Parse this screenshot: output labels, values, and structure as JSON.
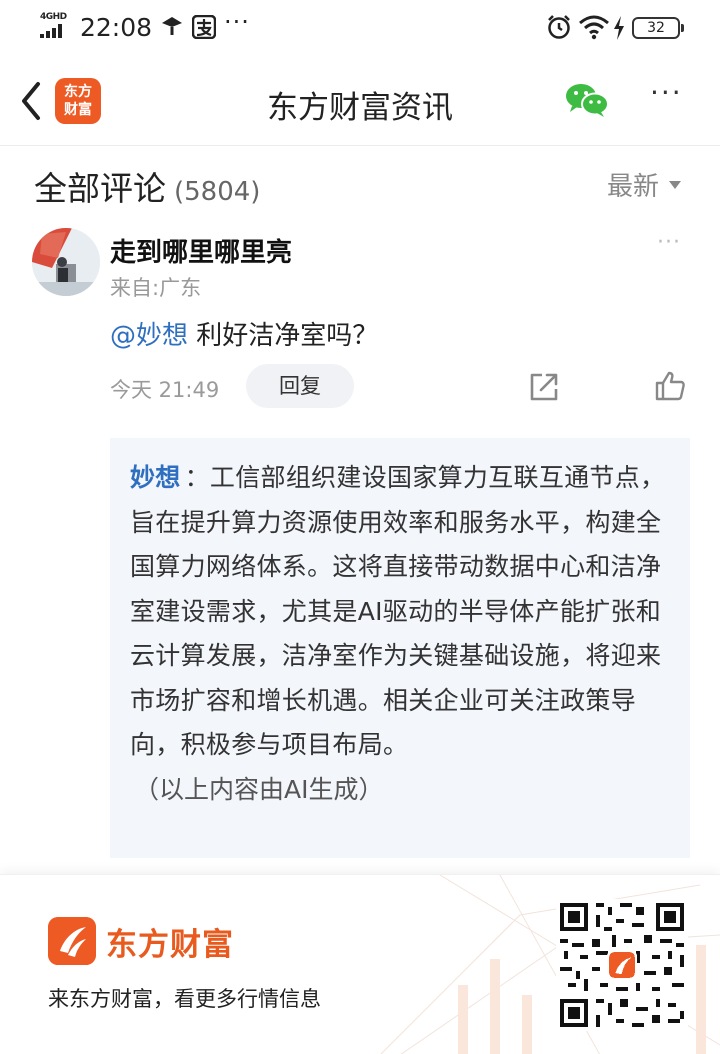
{
  "status_bar": {
    "network": "4GHD",
    "time": "22:08",
    "more": "···",
    "battery": "32"
  },
  "header": {
    "logo_text_1": "东方",
    "logo_text_2": "财富",
    "title": "东方财富资讯",
    "more": "···"
  },
  "comments": {
    "title": "全部评论",
    "count": "(5804)",
    "sort": "最新"
  },
  "comment": {
    "username": "走到哪里哪里亮",
    "location": "来自:广东",
    "mention": "@妙想",
    "text": " 利好洁净室吗？",
    "time": "今天 21:49",
    "reply_label": "回复",
    "more": "···"
  },
  "ai_reply": {
    "author": "妙想",
    "separator": "：",
    "text": "工信部组织建设国家算力互联互通节点，旨在提升算力资源使用效率和服务水平，构建全国算力网络体系。这将直接带动数据中心和洁净室建设需求，尤其是AI驱动的半导体产能扩张和云计算发展，洁净室作为关键基础设施，将迎来市场扩容和增长机遇。相关企业可关注政策导向，积极参与项目布局。",
    "note": "（以上内容由AI生成）"
  },
  "promo": {
    "brand": "东方财富",
    "slogan": "来东方财富，看更多行情信息"
  },
  "colors": {
    "brand_orange": "#ee5a24",
    "link_blue": "#2e6fc0",
    "wechat_green": "#3dbb43"
  },
  "icons": [
    "signal-icon",
    "hotspot-icon",
    "alipay-icon",
    "alarm-icon",
    "wifi-icon",
    "charging-icon",
    "battery-icon",
    "back-icon",
    "wechat-icon",
    "more-icon",
    "chevron-down-icon",
    "share-icon",
    "like-icon",
    "qr-code"
  ]
}
